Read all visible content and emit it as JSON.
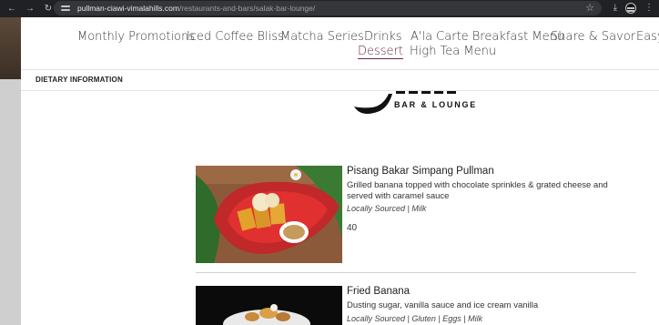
{
  "browser": {
    "url_host": "pullman-ciawi-vimalahills.com",
    "url_path": "/restaurants-and-bars/salak-bar-lounge/"
  },
  "menu_nav": {
    "items": [
      {
        "label": "Monthly Promotions"
      },
      {
        "label": "Iced Coffee Bliss"
      },
      {
        "label": "Matcha Series"
      },
      {
        "label": "Drinks"
      },
      {
        "label": "A'la Carte Breakfast Menu"
      },
      {
        "label": "Share & Savor"
      },
      {
        "label": "Easy"
      },
      {
        "label": "Dessert"
      },
      {
        "label": "High Tea Menu"
      }
    ],
    "active": "Dessert"
  },
  "dietary": {
    "label": "DIETARY INFORMATION"
  },
  "logo": {
    "subtitle": "BAR & LOUNGE"
  },
  "dishes": [
    {
      "title": "Pisang Bakar Simpang Pullman",
      "description": "Grilled banana topped with chocolate sprinkles & grated cheese and served with caramel sauce",
      "tags": "Locally Sourced | Milk",
      "price": "40"
    },
    {
      "title": "Fried Banana",
      "description": "Dusting sugar, vanilla sauce and ice cream vanilla",
      "tags": "Locally Sourced | Gluten | Eggs | Milk"
    }
  ],
  "colors": {
    "accent": "#6b2b47",
    "chrome": "#202124"
  }
}
